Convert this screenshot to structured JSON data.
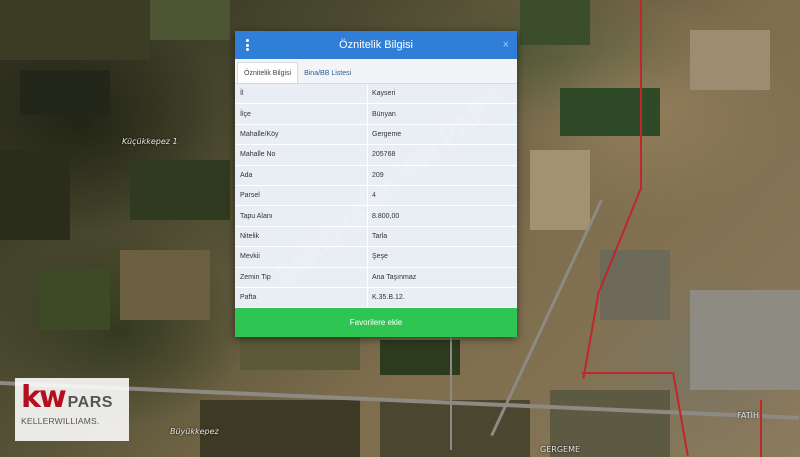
{
  "popup": {
    "title": "Öznitelik Bilgisi",
    "close_icon": "×",
    "tabs": [
      {
        "label": "Öznitelik Bilgisi",
        "active": true
      },
      {
        "label": "Bina/BB Listesi",
        "active": false
      }
    ],
    "rows": [
      {
        "key": "İl",
        "value": "Kayseri"
      },
      {
        "key": "İlçe",
        "value": "Bünyan"
      },
      {
        "key": "Mahalle/Köy",
        "value": "Gergeme"
      },
      {
        "key": "Mahalle No",
        "value": "205768"
      },
      {
        "key": "Ada",
        "value": "209"
      },
      {
        "key": "Parsel",
        "value": "4"
      },
      {
        "key": "Tapu Alanı",
        "value": "8.800,00"
      },
      {
        "key": "Nitelik",
        "value": "Tarla"
      },
      {
        "key": "Mevkii",
        "value": "Şeşe"
      },
      {
        "key": "Zemin Tip",
        "value": "Ana Taşınmaz"
      },
      {
        "key": "Pafta",
        "value": "K.35.B.12."
      }
    ],
    "favorite_button": "Favorilere ekle"
  },
  "map": {
    "labels": [
      {
        "text": "Küçükkepez 1"
      },
      {
        "text": "Büyükkepez"
      },
      {
        "text": "FATİH"
      },
      {
        "text": "GERGEME"
      }
    ]
  },
  "watermark": "Sahibinden KW PARS",
  "logo": {
    "main": "kw",
    "secondary": "PARS",
    "bottom": "KELLERWILLIAMS."
  },
  "colors": {
    "header": "#2f7fd8",
    "favorite_button": "#2ec553",
    "border_line": "#c0262a",
    "logo_red": "#b40f1e"
  }
}
